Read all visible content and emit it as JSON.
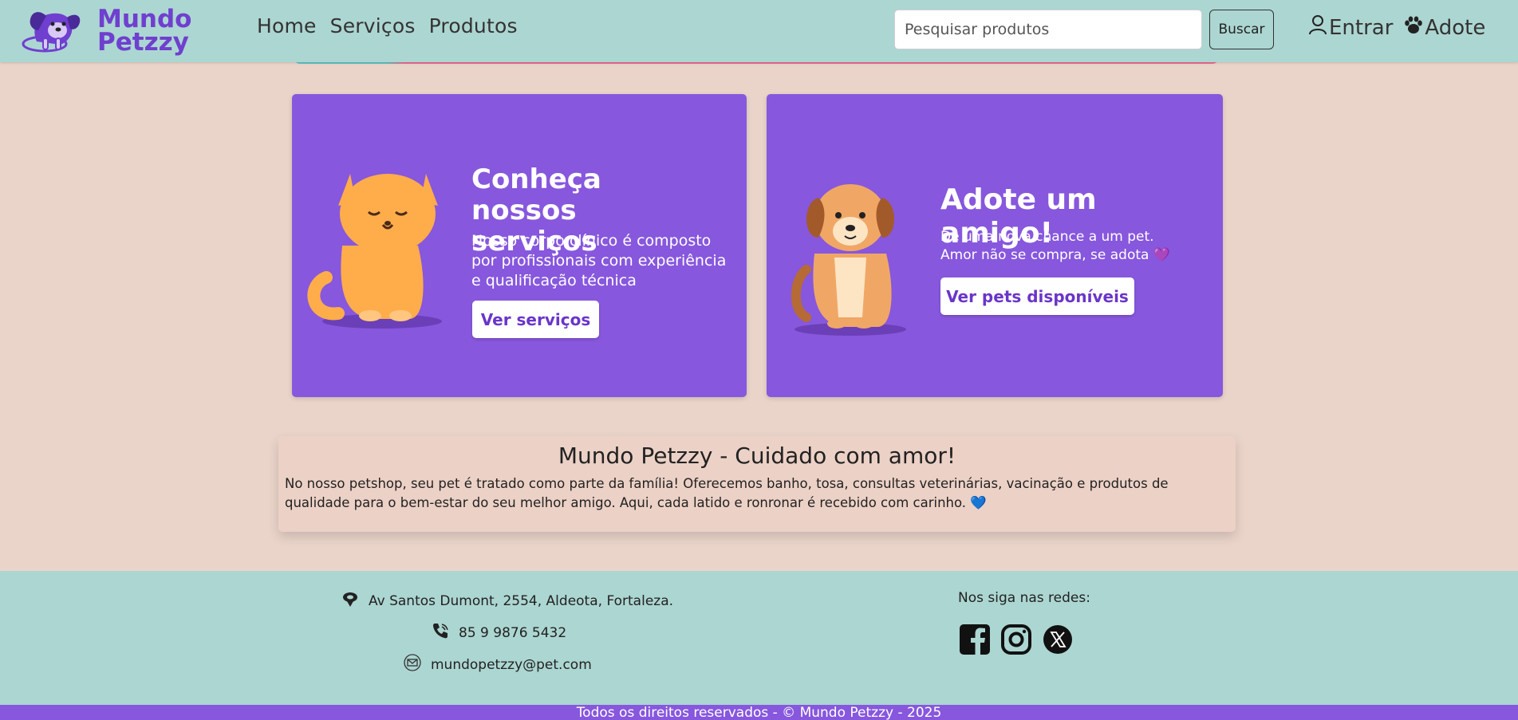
{
  "header": {
    "brand_line1": "Mundo",
    "brand_line2": "Petzzy",
    "nav": [
      "Home",
      "Serviços",
      "Produtos"
    ],
    "search_placeholder": "Pesquisar produtos",
    "search_button": "Buscar",
    "login_label": "Entrar",
    "adopt_label": "Adote"
  },
  "cards": {
    "services": {
      "title": "Conheça nossos serviços",
      "description": "Nosso corpo clínico é composto por profissionais com experiência e qualificação técnica",
      "button": "Ver serviços"
    },
    "adopt": {
      "title": "Adote um amigo!",
      "description_line1": "Dê uma nova chance a um pet.",
      "description_line2": "Amor não se compra, se adota 💜",
      "button": "Ver pets disponíveis"
    }
  },
  "about": {
    "title": "Mundo Petzzy - Cuidado com amor!",
    "text": "No nosso petshop, seu pet é tratado como parte da família! Oferecemos banho, tosa, consultas veterinárias, vacinação e produtos de qualidade para o bem-estar do seu melhor amigo. Aqui, cada latido e ronronar é recebido com carinho. 💙"
  },
  "footer": {
    "address": "Av Santos Dumont, 2554, Aldeota, Fortaleza.",
    "phone": "85 9 9876 5432",
    "email": "mundopetzzy@pet.com",
    "follow_label": "Nos siga nas redes:",
    "copyright": "Todos os direitos reservados - © Mundo Petzzy - 2025"
  },
  "colors": {
    "header_bg": "#acd6d2",
    "page_bg": "#ead4ca",
    "accent_purple": "#8757dd",
    "brand_purple": "#6f3fcf"
  },
  "icons": [
    "dog-logo-icon",
    "user-icon",
    "paw-icon",
    "location-icon",
    "phone-icon",
    "mail-icon",
    "facebook-icon",
    "instagram-icon",
    "x-icon"
  ]
}
